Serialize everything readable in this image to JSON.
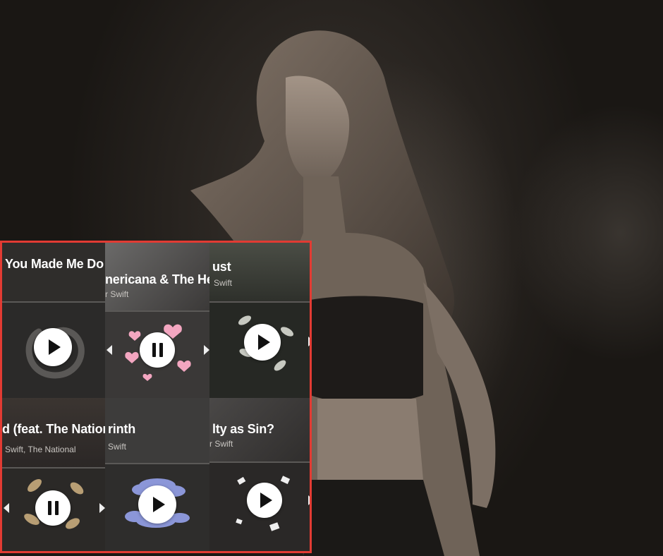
{
  "colors": {
    "frame": "#e23b33",
    "tile_bg": "#2b2a29",
    "play_button": "#ffffff",
    "divider": "#5b5957"
  },
  "tiles": [
    {
      "title": "You Made Me Do",
      "artist": "",
      "state": "play",
      "icon": "snake-icon"
    },
    {
      "title": "nericana & The Hea",
      "artist": "r Swift",
      "state": "pause",
      "icon": "hearts-icon"
    },
    {
      "title": "ust",
      "artist": "Swift",
      "state": "play",
      "icon": "leaves-icon"
    },
    {
      "title": "d (feat. The Nation",
      "artist": "Swift, The National",
      "state": "pause",
      "icon": "leaves-icon"
    },
    {
      "title": "rinth",
      "artist": "Swift",
      "state": "play",
      "icon": "clouds-icon"
    },
    {
      "title": "lty as Sin?",
      "artist": "r Swift",
      "state": "play",
      "icon": "paper-scraps-icon"
    }
  ]
}
